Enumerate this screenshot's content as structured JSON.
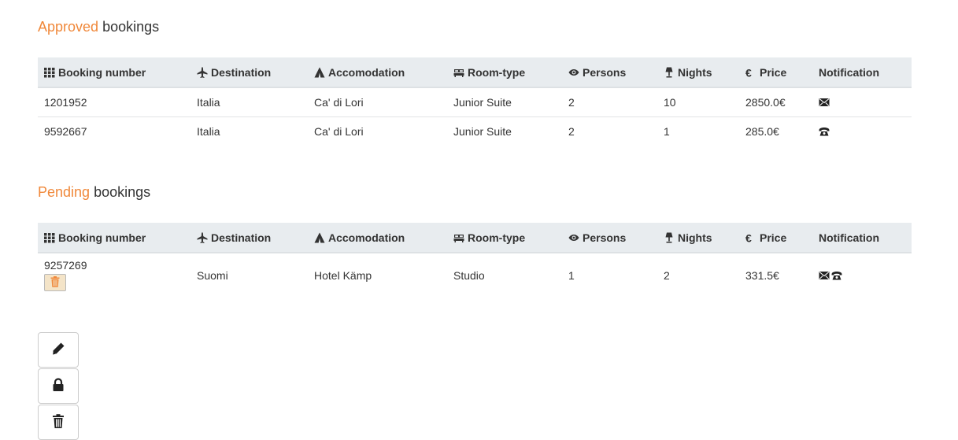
{
  "approved": {
    "title_accent": "Approved",
    "title_rest": " bookings",
    "rows": [
      {
        "booking_number": "1201952",
        "destination": "Italia",
        "accommodation": "Ca' di Lori",
        "room_type": "Junior Suite",
        "persons": "2",
        "nights": "10",
        "price": "2850.0€",
        "notification": [
          "envelope"
        ]
      },
      {
        "booking_number": "9592667",
        "destination": "Italia",
        "accommodation": "Ca' di Lori",
        "room_type": "Junior Suite",
        "persons": "2",
        "nights": "1",
        "price": "285.0€",
        "notification": [
          "phone"
        ]
      }
    ]
  },
  "pending": {
    "title_accent": "Pending",
    "title_rest": " bookings",
    "rows": [
      {
        "booking_number": "9257269",
        "destination": "Suomi",
        "accommodation": "Hotel Kämp",
        "room_type": "Studio",
        "persons": "1",
        "nights": "2",
        "price": "331.5€",
        "notification": [
          "envelope",
          "phone"
        ]
      }
    ]
  },
  "columns": {
    "booking_number": "Booking number",
    "destination": "Destination",
    "accommodation": "Accomodation",
    "room_type": "Room-type",
    "persons": "Persons",
    "nights": "Nights",
    "price": "Price",
    "notification": "Notification"
  },
  "column_icons": {
    "booking_number": "grid-icon",
    "destination": "plane-icon",
    "accommodation": "tent-icon",
    "room_type": "bed-icon",
    "persons": "eye-icon",
    "nights": "lamp-icon",
    "price": "euro-icon"
  },
  "colors": {
    "accent": "#f0883a",
    "header_bg": "#e8ecef",
    "delete_bg": "#f4e4c8"
  },
  "actions": [
    "pencil-icon",
    "lock-icon",
    "trash-icon"
  ]
}
